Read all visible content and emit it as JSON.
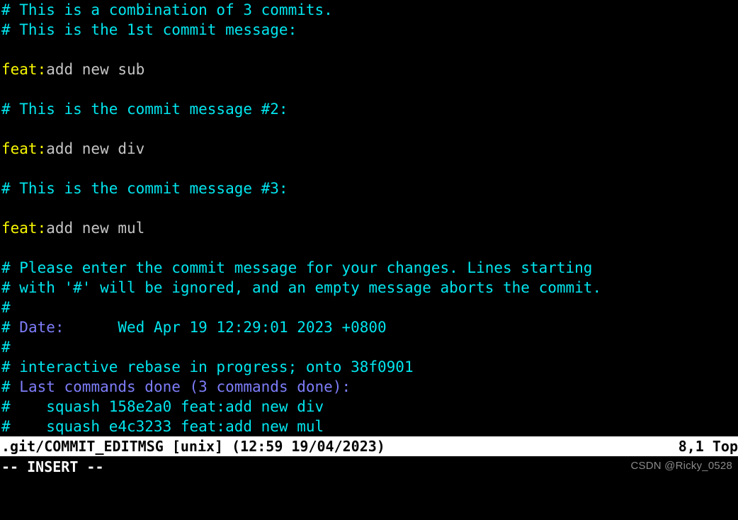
{
  "editor": {
    "name": "vim",
    "mode_label": "-- INSERT --",
    "background": "#000000",
    "colors": {
      "comment": "#00e5ee",
      "special": "#7d7dfa",
      "keyword": "#f7f700",
      "text": "#c5c5c5",
      "status_bg": "#ffffff",
      "status_fg": "#000000",
      "cmdline_fg": "#ffffff",
      "watermark": "#8a8a8a"
    }
  },
  "statusline": {
    "filename": ".git/COMMIT_EDITMSG",
    "fileformat": "[unix]",
    "timestamp": "(12:59 19/04/2023)",
    "left": ".git/COMMIT_EDITMSG [unix] (12:59 19/04/2023)",
    "ruler": "8,1",
    "scroll_position": "Top",
    "right": "8,1 Top"
  },
  "watermark": {
    "text": "CSDN @Ricky_0528"
  },
  "buffer": {
    "lines": [
      {
        "n": 1,
        "segments": [
          {
            "cls": "c-comment",
            "text": "# This is a combination of 3 commits."
          }
        ]
      },
      {
        "n": 2,
        "segments": [
          {
            "cls": "c-comment",
            "text": "# This is the 1st commit message:"
          }
        ]
      },
      {
        "n": 3,
        "segments": [
          {
            "cls": "c-text",
            "text": ""
          }
        ]
      },
      {
        "n": 4,
        "segments": [
          {
            "cls": "c-keyword",
            "text": "feat:"
          },
          {
            "cls": "c-text",
            "text": "add new sub"
          }
        ]
      },
      {
        "n": 5,
        "segments": [
          {
            "cls": "c-text",
            "text": ""
          }
        ]
      },
      {
        "n": 6,
        "segments": [
          {
            "cls": "c-comment",
            "text": "# This is the commit message #2:"
          }
        ]
      },
      {
        "n": 7,
        "segments": [
          {
            "cls": "c-text",
            "text": ""
          }
        ]
      },
      {
        "n": 8,
        "segments": [
          {
            "cls": "c-keyword",
            "text": "feat:"
          },
          {
            "cls": "c-text",
            "text": "add new div"
          }
        ]
      },
      {
        "n": 9,
        "segments": [
          {
            "cls": "c-text",
            "text": ""
          }
        ]
      },
      {
        "n": 10,
        "segments": [
          {
            "cls": "c-comment",
            "text": "# This is the commit message #3:"
          }
        ]
      },
      {
        "n": 11,
        "segments": [
          {
            "cls": "c-text",
            "text": ""
          }
        ]
      },
      {
        "n": 12,
        "segments": [
          {
            "cls": "c-keyword",
            "text": "feat:"
          },
          {
            "cls": "c-text",
            "text": "add new mul"
          }
        ]
      },
      {
        "n": 13,
        "segments": [
          {
            "cls": "c-text",
            "text": ""
          }
        ]
      },
      {
        "n": 14,
        "segments": [
          {
            "cls": "c-comment",
            "text": "# Please enter the commit message for your changes. Lines starting"
          }
        ]
      },
      {
        "n": 15,
        "segments": [
          {
            "cls": "c-comment",
            "text": "# with '#' will be ignored, and an empty message aborts the commit."
          }
        ]
      },
      {
        "n": 16,
        "segments": [
          {
            "cls": "c-comment",
            "text": "#"
          }
        ]
      },
      {
        "n": 17,
        "segments": [
          {
            "cls": "c-comment",
            "text": "# "
          },
          {
            "cls": "c-special",
            "text": "Date:"
          },
          {
            "cls": "c-comment",
            "text": "      Wed Apr 19 12:29:01 2023 +0800"
          }
        ]
      },
      {
        "n": 18,
        "segments": [
          {
            "cls": "c-comment",
            "text": "#"
          }
        ]
      },
      {
        "n": 19,
        "segments": [
          {
            "cls": "c-comment",
            "text": "# interactive rebase in progress; onto 38f0901"
          }
        ]
      },
      {
        "n": 20,
        "segments": [
          {
            "cls": "c-comment",
            "text": "# "
          },
          {
            "cls": "c-special",
            "text": "Last commands done (3 commands done):"
          }
        ]
      },
      {
        "n": 21,
        "segments": [
          {
            "cls": "c-comment",
            "text": "#    squash 158e2a0 feat:add new div"
          }
        ]
      },
      {
        "n": 22,
        "segments": [
          {
            "cls": "c-comment",
            "text": "#    squash e4c3233 feat:add new mul"
          }
        ]
      }
    ]
  }
}
